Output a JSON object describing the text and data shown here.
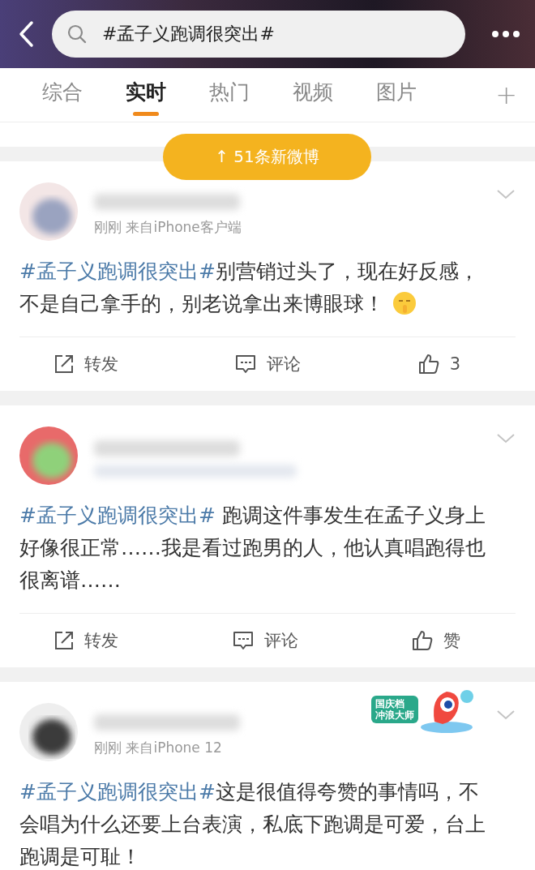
{
  "header": {
    "search_value": "#孟子义跑调很突出#"
  },
  "tabs": [
    {
      "label": "综合",
      "selected": false
    },
    {
      "label": "实时",
      "selected": true
    },
    {
      "label": "热门",
      "selected": false
    },
    {
      "label": "视频",
      "selected": false
    },
    {
      "label": "图片",
      "selected": false
    }
  ],
  "tab_add": "+",
  "new_posts_button": "↑ 51条新微博",
  "posts": [
    {
      "meta": "刚刚  来自iPhone客户端",
      "hashtag": "#孟子义跑调很突出#",
      "text": "别营销过头了，现在好反感，不是自己拿手的，别老说拿出来博眼球！",
      "emoji": true,
      "actions": [
        {
          "kind": "repost",
          "label": "转发"
        },
        {
          "kind": "comment",
          "label": "评论"
        },
        {
          "kind": "like",
          "label": "3"
        }
      ]
    },
    {
      "hashtag": "#孟子义跑调很突出#",
      "text": " 跑调这件事发生在孟子义身上好像很正常……我是看过跑男的人，他认真唱跑得也很离谱……",
      "emoji": false,
      "actions": [
        {
          "kind": "repost",
          "label": "转发"
        },
        {
          "kind": "comment",
          "label": "评论"
        },
        {
          "kind": "like",
          "label": "赞"
        }
      ]
    },
    {
      "meta": "刚刚  来自iPhone 12",
      "hashtag": "#孟子义跑调很突出#",
      "text": "这是很值得夸赞的事情吗，不会唱为什么还要上台表演，私底下跑调是可爱，台上跑调是可耻！",
      "emoji": false,
      "badge": [
        "国庆档",
        "冲浪大师"
      ]
    }
  ]
}
